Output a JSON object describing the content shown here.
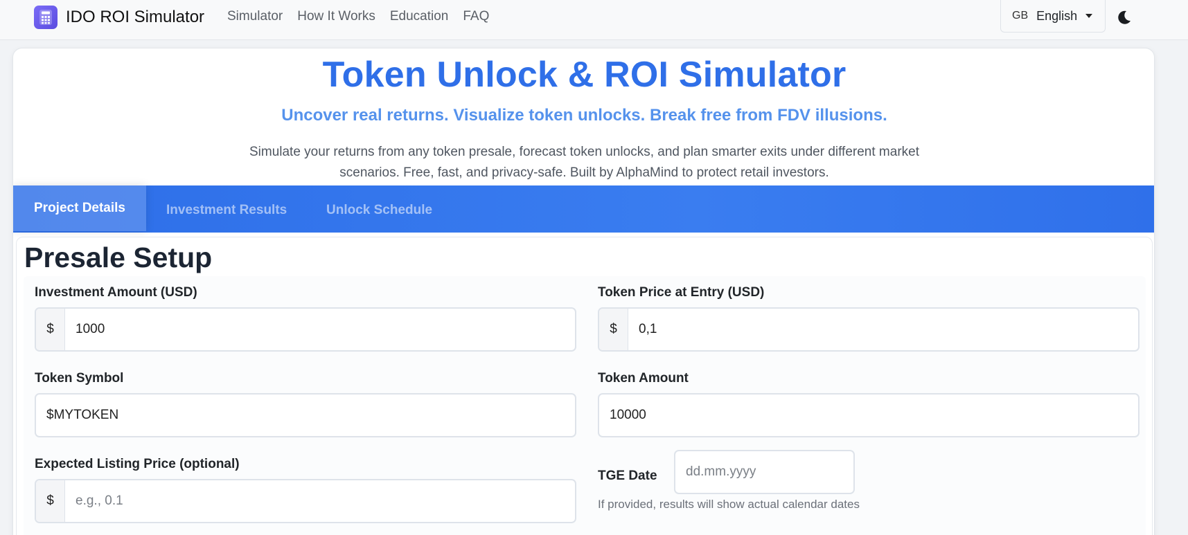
{
  "nav": {
    "brand": "IDO ROI Simulator",
    "links": [
      "Simulator",
      "How It Works",
      "Education",
      "FAQ"
    ],
    "language_code": "GB",
    "language": "English"
  },
  "hero": {
    "title": "Token Unlock & ROI Simulator",
    "subtitle": "Uncover real returns. Visualize token unlocks. Break free from FDV illusions.",
    "description": "Simulate your returns from any token presale, forecast token unlocks, and plan smarter exits under different market scenarios. Free, fast, and privacy-safe. Built by AlphaMind to protect retail investors."
  },
  "tabs": [
    "Project Details",
    "Investment Results",
    "Unlock Schedule"
  ],
  "section_title": "Presale Setup",
  "form": {
    "investment_label": "Investment Amount (USD)",
    "investment_prefix": "$",
    "investment_value": "1000",
    "price_label": "Token Price at Entry (USD)",
    "price_prefix": "$",
    "price_value": "0,1",
    "symbol_label": "Token Symbol",
    "symbol_value": "$MYTOKEN",
    "amount_label": "Token Amount",
    "amount_value": "10000",
    "listing_label": "Expected Listing Price (optional)",
    "listing_prefix": "$",
    "listing_placeholder": "e.g., 0.1",
    "tge_label": "TGE Date",
    "tge_placeholder": "dd.mm.yyyy",
    "tge_hint": "If provided, results will show actual calendar dates"
  },
  "colors": {
    "accent": "#2f6fe8",
    "subtitle": "#5592ec",
    "tab_bar": "#3278ee"
  }
}
